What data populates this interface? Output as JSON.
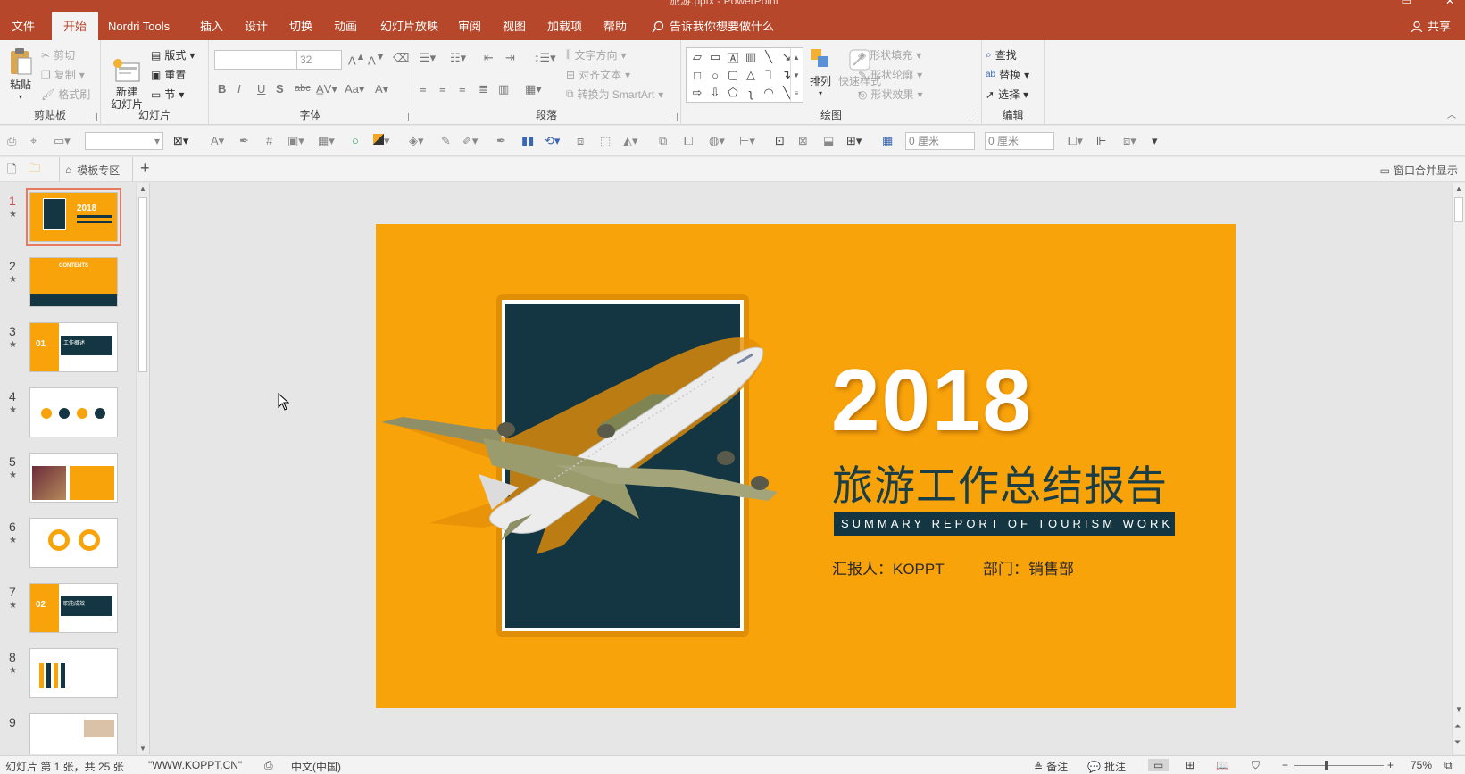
{
  "window": {
    "doc_title": "旅游.pptx - PowerPoint"
  },
  "tabs": [
    {
      "label": "文件"
    },
    {
      "label": "开始"
    },
    {
      "label": "Nordri Tools"
    },
    {
      "label": "插入"
    },
    {
      "label": "设计"
    },
    {
      "label": "切换"
    },
    {
      "label": "动画"
    },
    {
      "label": "幻灯片放映"
    },
    {
      "label": "审阅"
    },
    {
      "label": "视图"
    },
    {
      "label": "加载项"
    },
    {
      "label": "帮助"
    }
  ],
  "tell_me": "告诉我你想要做什么",
  "share": "共享",
  "ribbon": {
    "clipboard": {
      "label": "剪贴板",
      "paste": "粘贴",
      "cut": "剪切",
      "copy": "复制",
      "format_painter": "格式刷"
    },
    "slides": {
      "label": "幻灯片",
      "new_slide": "新建\n幻灯片",
      "layout": "版式",
      "reset": "重置",
      "section": "节"
    },
    "font": {
      "label": "字体",
      "font_name": "",
      "font_size": "32"
    },
    "paragraph": {
      "label": "段落",
      "text_direction": "文字方向",
      "align_text": "对齐文本",
      "smartart": "转换为 SmartArt"
    },
    "drawing": {
      "label": "绘图",
      "arrange": "排列",
      "quick_styles": "快速样式",
      "shape_fill": "形状填充",
      "shape_outline": "形状轮廓",
      "shape_effects": "形状效果"
    },
    "editing": {
      "label": "编辑",
      "find": "查找",
      "replace": "替换",
      "select": "选择"
    }
  },
  "toolbar2": {
    "width_value": "0 厘米",
    "height_value": "0 厘米"
  },
  "bar3": {
    "template_tab": "模板专区",
    "merge_windows": "窗口合并显示"
  },
  "thumbnails": [
    {
      "num": "1"
    },
    {
      "num": "2"
    },
    {
      "num": "3"
    },
    {
      "num": "4"
    },
    {
      "num": "5"
    },
    {
      "num": "6"
    },
    {
      "num": "7"
    },
    {
      "num": "8"
    },
    {
      "num": "9"
    }
  ],
  "slide": {
    "year": "2018",
    "title_cn": "旅游工作总结报告",
    "subtitle_en": "SUMMARY REPORT OF TOURISM WORK",
    "reporter": "汇报人：KOPPT",
    "department": "部门：销售部",
    "colors": {
      "background": "#f9a30a",
      "dark": "#143642"
    }
  },
  "thumb_text": {
    "t1_year": "2018",
    "t2_title": "CONTENTS",
    "t3_num": "01",
    "t3_title": "工作概述",
    "t7_num": "02",
    "t7_title": "职能成效"
  },
  "status": {
    "slide_info": "幻灯片 第 1 张，共 25 张",
    "theme": "\"WWW.KOPPT.CN\"",
    "language": "中文(中国)",
    "notes": "备注",
    "comments": "批注",
    "zoom": "75%"
  }
}
